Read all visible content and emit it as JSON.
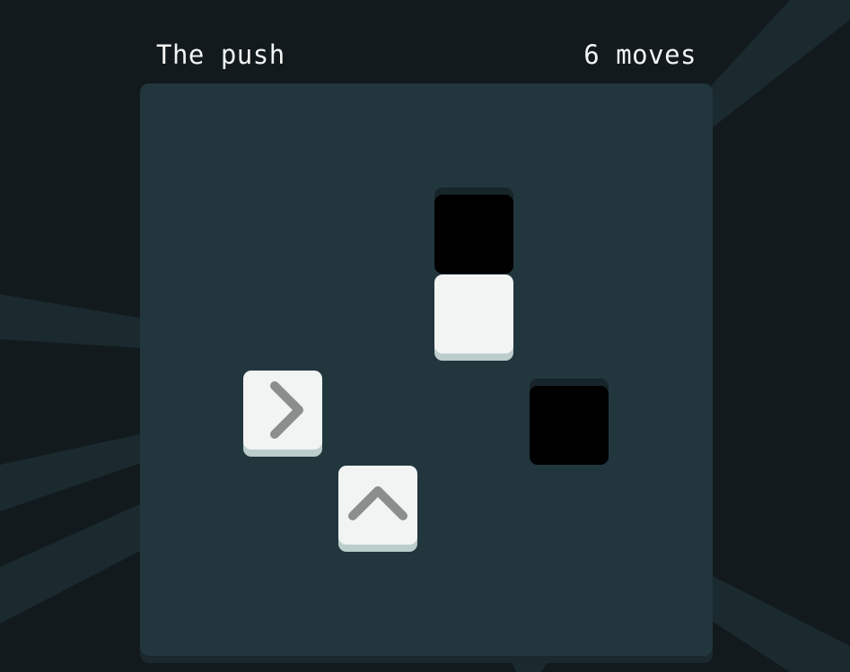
{
  "header": {
    "level_title": "The push",
    "move_count": "6 moves"
  },
  "colors": {
    "page_background": "#121a1d",
    "ray_color": "#1a2a2f",
    "board_background": "#22363d",
    "white_block": "#f1f4f3",
    "white_block_side": "#bccecb",
    "hole": "#000000",
    "arrow_glyph": "#8a8e8c"
  },
  "board": {
    "pieces": [
      {
        "kind": "hole",
        "icon": "none"
      },
      {
        "kind": "block",
        "icon": "none"
      },
      {
        "kind": "block",
        "icon": "chevron-right-icon"
      },
      {
        "kind": "hole",
        "icon": "none"
      },
      {
        "kind": "block",
        "icon": "chevron-up-icon"
      }
    ]
  }
}
